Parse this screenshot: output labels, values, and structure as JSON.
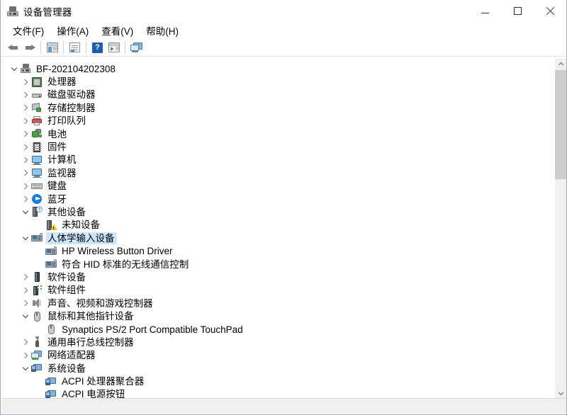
{
  "window": {
    "title": "设备管理器",
    "title_icon": "device-manager-icon",
    "minimize_label": "最小化",
    "maximize_label": "最大化",
    "close_label": "关闭"
  },
  "menubar": {
    "items": [
      {
        "label": "文件(F)",
        "name": "menu-file"
      },
      {
        "label": "操作(A)",
        "name": "menu-action"
      },
      {
        "label": "查看(V)",
        "name": "menu-view"
      },
      {
        "label": "帮助(H)",
        "name": "menu-help"
      }
    ]
  },
  "toolbar": {
    "buttons": [
      {
        "name": "back-button",
        "icon": "arrow-left-icon",
        "tooltip": "后退"
      },
      {
        "name": "forward-button",
        "icon": "arrow-right-icon",
        "tooltip": "前进"
      },
      {
        "name": "show-hide-tree-button",
        "icon": "window-pane-icon",
        "tooltip": "显示/隐藏控制台树"
      },
      {
        "name": "properties-button",
        "icon": "properties-icon",
        "tooltip": "属性"
      },
      {
        "name": "help-button",
        "icon": "help-icon",
        "glyph": "?",
        "tooltip": "帮助"
      },
      {
        "name": "update-driver-button",
        "icon": "update-driver-icon",
        "tooltip": "更新驱动程序"
      },
      {
        "name": "scan-hardware-button",
        "icon": "scan-monitor-icon",
        "tooltip": "扫描检测硬件改动"
      }
    ]
  },
  "tree": {
    "root": {
      "label": "BF-202104202308",
      "icon": "computer-root-icon",
      "expanded": true,
      "level": 0
    },
    "nodes": [
      {
        "label": "处理器",
        "icon": "cpu-icon",
        "state": "collapsed",
        "level": 1,
        "selected": false
      },
      {
        "label": "磁盘驱动器",
        "icon": "disk-drive-icon",
        "state": "collapsed",
        "level": 1,
        "selected": false
      },
      {
        "label": "存储控制器",
        "icon": "storage-controller-icon",
        "state": "collapsed",
        "level": 1,
        "selected": false
      },
      {
        "label": "打印队列",
        "icon": "printer-icon",
        "state": "collapsed",
        "level": 1,
        "selected": false
      },
      {
        "label": "电池",
        "icon": "battery-icon",
        "state": "collapsed",
        "level": 1,
        "selected": false
      },
      {
        "label": "固件",
        "icon": "firmware-icon",
        "state": "collapsed",
        "level": 1,
        "selected": false
      },
      {
        "label": "计算机",
        "icon": "computer-icon",
        "state": "collapsed",
        "level": 1,
        "selected": false
      },
      {
        "label": "监视器",
        "icon": "monitor-icon",
        "state": "collapsed",
        "level": 1,
        "selected": false
      },
      {
        "label": "键盘",
        "icon": "keyboard-icon",
        "state": "collapsed",
        "level": 1,
        "selected": false
      },
      {
        "label": "蓝牙",
        "icon": "bluetooth-icon",
        "state": "collapsed",
        "level": 1,
        "selected": false
      },
      {
        "label": "其他设备",
        "icon": "other-device-icon",
        "state": "expanded",
        "level": 1,
        "selected": false
      },
      {
        "label": "未知设备",
        "icon": "unknown-device-warning-icon",
        "state": "leaf",
        "level": 2,
        "selected": false
      },
      {
        "label": "人体学输入设备",
        "icon": "hid-icon",
        "state": "expanded",
        "level": 1,
        "selected": true
      },
      {
        "label": "HP Wireless Button Driver",
        "icon": "hid-icon",
        "state": "leaf",
        "level": 2,
        "selected": false
      },
      {
        "label": "符合 HID 标准的无线通信控制",
        "icon": "hid-icon",
        "state": "leaf",
        "level": 2,
        "selected": false
      },
      {
        "label": "软件设备",
        "icon": "software-device-icon",
        "state": "collapsed",
        "level": 1,
        "selected": false
      },
      {
        "label": "软件组件",
        "icon": "software-component-icon",
        "state": "collapsed",
        "level": 1,
        "selected": false
      },
      {
        "label": "声音、视频和游戏控制器",
        "icon": "sound-icon",
        "state": "collapsed",
        "level": 1,
        "selected": false
      },
      {
        "label": "鼠标和其他指针设备",
        "icon": "mouse-icon",
        "state": "expanded",
        "level": 1,
        "selected": false
      },
      {
        "label": "Synaptics PS/2 Port Compatible TouchPad",
        "icon": "mouse-icon",
        "state": "leaf",
        "level": 2,
        "selected": false
      },
      {
        "label": "通用串行总线控制器",
        "icon": "usb-icon",
        "state": "collapsed",
        "level": 1,
        "selected": false
      },
      {
        "label": "网络适配器",
        "icon": "network-adapter-icon",
        "state": "collapsed",
        "level": 1,
        "selected": false
      },
      {
        "label": "系统设备",
        "icon": "system-device-icon",
        "state": "expanded",
        "level": 1,
        "selected": false
      },
      {
        "label": "ACPI 处理器聚合器",
        "icon": "system-device-icon",
        "state": "leaf",
        "level": 2,
        "selected": false
      },
      {
        "label": "ACPI 电源按钮",
        "icon": "system-device-icon",
        "state": "leaf",
        "level": 2,
        "selected": false
      }
    ]
  },
  "scrollbar": {
    "up_arrow": "chevron-up-icon",
    "down_arrow": "chevron-down-icon",
    "thumb_name": "vertical-scroll-thumb"
  },
  "statusbar": {
    "text": ""
  },
  "colors": {
    "selection": "#cce8ff",
    "window_bg": "#ffffff",
    "toolbar_bg": "#ffffff",
    "statusbar_bg": "#f0f0f0",
    "scrollbar_track": "#f0f0f0",
    "scrollbar_thumb": "#cdcdcd",
    "window_border": "#9eadbd",
    "text": "#000000"
  }
}
